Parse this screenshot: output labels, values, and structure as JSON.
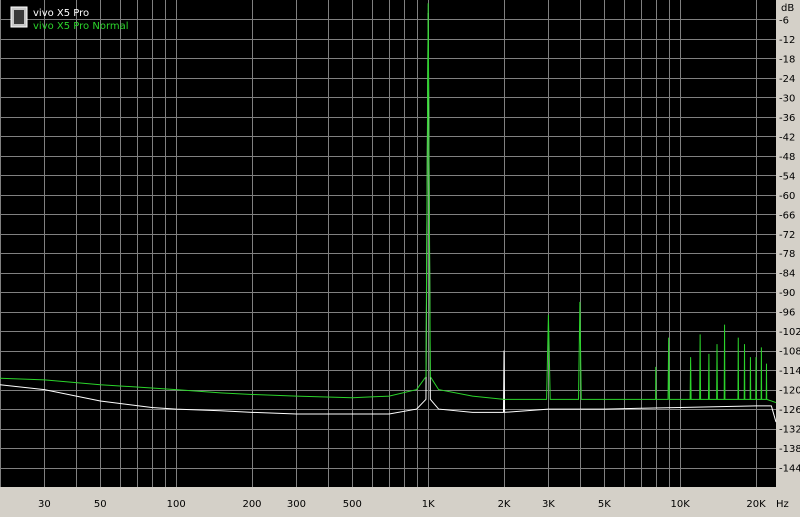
{
  "chart_data": {
    "type": "line",
    "title": "",
    "xlabel": "Hz",
    "ylabel": "dB",
    "x_scale": "log",
    "xlim": [
      20,
      24000
    ],
    "ylim": [
      -150,
      0
    ],
    "grid": true,
    "legend_position": "top-left",
    "background": "#000000",
    "grid_color": "#808080",
    "x_ticks": [
      {
        "value": 30,
        "label": "30"
      },
      {
        "value": 50,
        "label": "50"
      },
      {
        "value": 100,
        "label": "100"
      },
      {
        "value": 200,
        "label": "200"
      },
      {
        "value": 300,
        "label": "300"
      },
      {
        "value": 500,
        "label": "500"
      },
      {
        "value": 1000,
        "label": "1K"
      },
      {
        "value": 2000,
        "label": "2K"
      },
      {
        "value": 3000,
        "label": "3K"
      },
      {
        "value": 5000,
        "label": "5K"
      },
      {
        "value": 10000,
        "label": "10K"
      },
      {
        "value": 20000,
        "label": "20K"
      }
    ],
    "x_minor_grid": [
      20,
      30,
      40,
      50,
      60,
      70,
      80,
      90,
      200,
      300,
      400,
      500,
      600,
      700,
      800,
      900,
      2000,
      3000,
      4000,
      5000,
      6000,
      7000,
      8000,
      9000,
      20000
    ],
    "y_ticks": [
      -6,
      -12,
      -18,
      -24,
      -30,
      -36,
      -42,
      -48,
      -54,
      -60,
      -66,
      -72,
      -78,
      -84,
      -90,
      -96,
      -102,
      -108,
      -114,
      -120,
      -126,
      -132,
      -138,
      -144
    ],
    "series": [
      {
        "name": "vivo X5 Pro",
        "color": "#ffffff",
        "points": [
          [
            20,
            -118.5
          ],
          [
            30,
            -120
          ],
          [
            50,
            -123.5
          ],
          [
            80,
            -125.5
          ],
          [
            100,
            -126
          ],
          [
            150,
            -126.5
          ],
          [
            200,
            -127
          ],
          [
            300,
            -127.5
          ],
          [
            500,
            -127.5
          ],
          [
            700,
            -127.5
          ],
          [
            900,
            -126
          ],
          [
            980,
            -123
          ],
          [
            1000,
            -4
          ],
          [
            1020,
            -123
          ],
          [
            1100,
            -126
          ],
          [
            1500,
            -127
          ],
          [
            1990,
            -127
          ],
          [
            2000,
            -108
          ],
          [
            2010,
            -127
          ],
          [
            3000,
            -126
          ],
          [
            5000,
            -126
          ],
          [
            10000,
            -125.5
          ],
          [
            20000,
            -125
          ],
          [
            23000,
            -125
          ],
          [
            24000,
            -130
          ]
        ]
      },
      {
        "name": "vivo X5 Pro Normal",
        "color": "#2bd42b",
        "points": [
          [
            20,
            -116.5
          ],
          [
            30,
            -117
          ],
          [
            50,
            -118.5
          ],
          [
            80,
            -119.5
          ],
          [
            100,
            -120
          ],
          [
            150,
            -121
          ],
          [
            200,
            -121.5
          ],
          [
            300,
            -122
          ],
          [
            500,
            -122.5
          ],
          [
            700,
            -122
          ],
          [
            900,
            -120
          ],
          [
            980,
            -116
          ],
          [
            1000,
            -1
          ],
          [
            1020,
            -116
          ],
          [
            1100,
            -120
          ],
          [
            1500,
            -122
          ],
          [
            2000,
            -123
          ],
          [
            2950,
            -123
          ],
          [
            3000,
            -97
          ],
          [
            3050,
            -123
          ],
          [
            3950,
            -123
          ],
          [
            4000,
            -93
          ],
          [
            4050,
            -123
          ],
          [
            5000,
            -123
          ],
          [
            7000,
            -123
          ],
          [
            7990,
            -123
          ],
          [
            8000,
            -113
          ],
          [
            8010,
            -123
          ],
          [
            8950,
            -123
          ],
          [
            9000,
            -104
          ],
          [
            9050,
            -123
          ],
          [
            10950,
            -123
          ],
          [
            11000,
            -110
          ],
          [
            11050,
            -123
          ],
          [
            11950,
            -123
          ],
          [
            12000,
            -103
          ],
          [
            12050,
            -123
          ],
          [
            12950,
            -123
          ],
          [
            13000,
            -109
          ],
          [
            13050,
            -123
          ],
          [
            13950,
            -123
          ],
          [
            14000,
            -106
          ],
          [
            14050,
            -123
          ],
          [
            14950,
            -123
          ],
          [
            15000,
            -100
          ],
          [
            15050,
            -123
          ],
          [
            16950,
            -123
          ],
          [
            17000,
            -104
          ],
          [
            17050,
            -123
          ],
          [
            17950,
            -123
          ],
          [
            18000,
            -106
          ],
          [
            18050,
            -123
          ],
          [
            18950,
            -123
          ],
          [
            19000,
            -110
          ],
          [
            19050,
            -123
          ],
          [
            19950,
            -123
          ],
          [
            20000,
            -110
          ],
          [
            20050,
            -123
          ],
          [
            20950,
            -123
          ],
          [
            21000,
            -107
          ],
          [
            21050,
            -123
          ],
          [
            21950,
            -123
          ],
          [
            22000,
            -112
          ],
          [
            22050,
            -123
          ],
          [
            24000,
            -124
          ]
        ]
      }
    ]
  }
}
